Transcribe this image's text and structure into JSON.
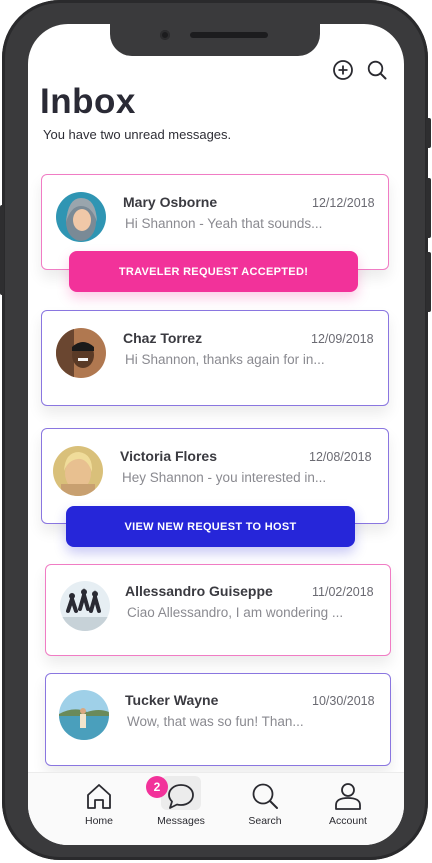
{
  "header": {
    "title": "Inbox",
    "subtitle": "You have two unread messages.",
    "add_icon": "plus-circle-icon",
    "search_icon": "search-icon"
  },
  "messages": [
    {
      "name": "Mary Osborne",
      "date": "12/12/2018",
      "preview": "Hi Shannon - Yeah that sounds...",
      "status": "unread",
      "border_color": "#f07cc4"
    },
    {
      "name": "Chaz Torrez",
      "date": "12/09/2018",
      "preview": "Hi Shannon, thanks again for in...",
      "status": "read",
      "border_color": "#8a76e0"
    },
    {
      "name": "Victoria Flores",
      "date": "12/08/2018",
      "preview": "Hey Shannon - you interested in...",
      "status": "read",
      "border_color": "#8a76e0"
    },
    {
      "name": "Allessandro Guiseppe",
      "date": "11/02/2018",
      "preview": "Ciao Allessandro, I am wondering ...",
      "status": "unread",
      "border_color": "#f07cc4"
    },
    {
      "name": "Tucker Wayne",
      "date": "10/30/2018",
      "preview": "Wow, that was so fun! Than...",
      "status": "read",
      "border_color": "#8a76e0"
    }
  ],
  "actions": {
    "traveler_accepted": "TRAVELER REQUEST ACCEPTED!",
    "view_host_request": "VIEW NEW REQUEST TO HOST"
  },
  "tabbar": {
    "home": "Home",
    "messages": "Messages",
    "search": "Search",
    "account": "Account",
    "messages_badge": "2",
    "active_tab": "Messages"
  },
  "colors": {
    "accent_pink": "#f2329a",
    "accent_blue": "#2626d9",
    "unread_border": "#f07cc4",
    "read_border": "#8a76e0"
  }
}
